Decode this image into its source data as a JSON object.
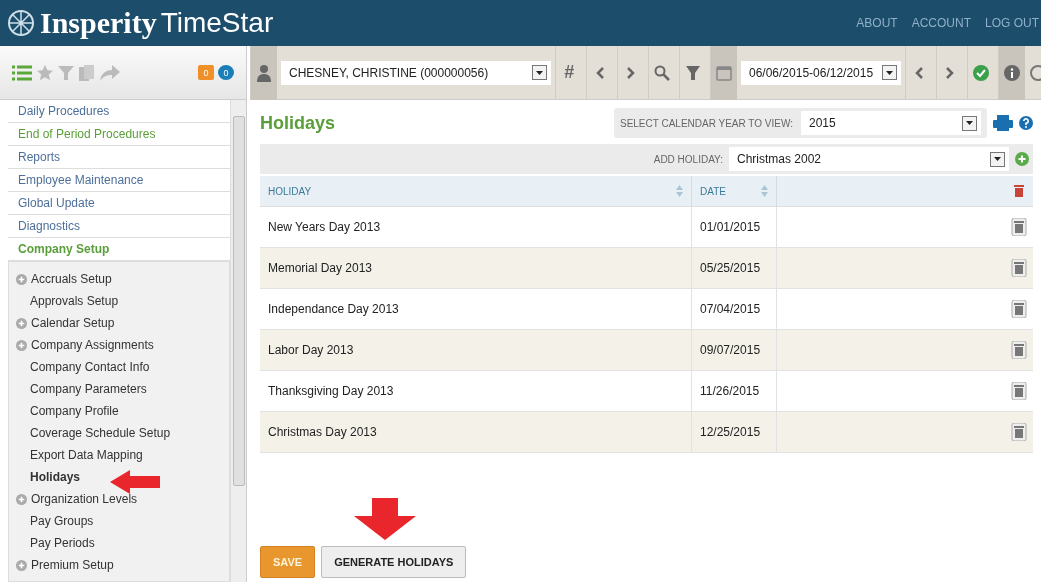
{
  "header": {
    "brand": "Insperity",
    "product": "TimeStar",
    "links": [
      "ABOUT",
      "ACCOUNT",
      "LOG OUT"
    ]
  },
  "sidebar": {
    "alerts": "0",
    "messages": "0",
    "menu": [
      {
        "label": "Daily Procedures",
        "selected": false,
        "hover": false
      },
      {
        "label": "End of Period Procedures",
        "selected": false,
        "hover": true
      },
      {
        "label": "Reports",
        "selected": false,
        "hover": false
      },
      {
        "label": "Employee Maintenance",
        "selected": false,
        "hover": false
      },
      {
        "label": "Global Update",
        "selected": false,
        "hover": false
      },
      {
        "label": "Diagnostics",
        "selected": false,
        "hover": false
      },
      {
        "label": "Company Setup",
        "selected": true,
        "hover": false
      }
    ],
    "submenu": [
      {
        "label": "Accruals Setup",
        "expandable": true,
        "selected": false
      },
      {
        "label": "Approvals Setup",
        "expandable": false,
        "selected": false
      },
      {
        "label": "Calendar Setup",
        "expandable": true,
        "selected": false
      },
      {
        "label": "Company Assignments",
        "expandable": true,
        "selected": false
      },
      {
        "label": "Company Contact Info",
        "expandable": false,
        "selected": false
      },
      {
        "label": "Company Parameters",
        "expandable": false,
        "selected": false
      },
      {
        "label": "Company Profile",
        "expandable": false,
        "selected": false
      },
      {
        "label": "Coverage Schedule Setup",
        "expandable": false,
        "selected": false
      },
      {
        "label": "Export Data Mapping",
        "expandable": false,
        "selected": false
      },
      {
        "label": "Holidays",
        "expandable": false,
        "selected": true
      },
      {
        "label": "Organization Levels",
        "expandable": true,
        "selected": false
      },
      {
        "label": "Pay Groups",
        "expandable": false,
        "selected": false
      },
      {
        "label": "Pay Periods",
        "expandable": false,
        "selected": false
      },
      {
        "label": "Premium Setup",
        "expandable": true,
        "selected": false
      }
    ]
  },
  "toolbar": {
    "employee": "CHESNEY, CHRISTINE (000000056)",
    "date_range": "06/06/2015-06/12/2015",
    "hash": "#"
  },
  "page": {
    "title": "Holidays",
    "year_label": "SELECT CALENDAR YEAR TO VIEW:",
    "year": "2015",
    "add_label": "ADD HOLIDAY:",
    "add_value": "Christmas 2002"
  },
  "table": {
    "columns": [
      "HOLIDAY",
      "DATE"
    ],
    "rows": [
      {
        "holiday": "New Years Day 2013",
        "date": "01/01/2015"
      },
      {
        "holiday": "Memorial Day 2013",
        "date": "05/25/2015"
      },
      {
        "holiday": "Independance Day 2013",
        "date": "07/04/2015"
      },
      {
        "holiday": "Labor Day 2013",
        "date": "09/07/2015"
      },
      {
        "holiday": "Thanksgiving Day 2013",
        "date": "11/26/2015"
      },
      {
        "holiday": "Christmas Day 2013",
        "date": "12/25/2015"
      }
    ]
  },
  "buttons": [
    {
      "label": "SAVE",
      "kind": "primary"
    },
    {
      "label": "GENERATE HOLIDAYS",
      "kind": "secondary"
    }
  ]
}
